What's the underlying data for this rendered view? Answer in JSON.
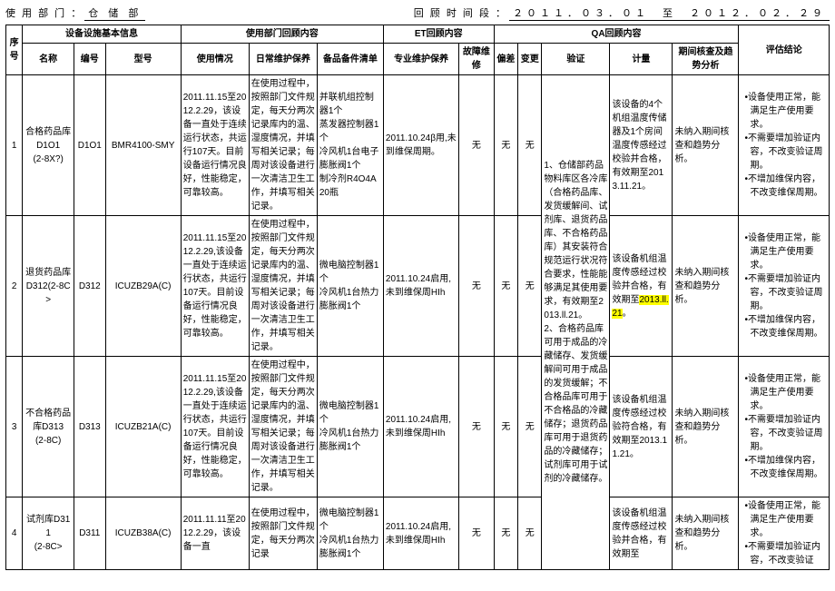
{
  "top": {
    "dept_label": "使 用 部 门 ：",
    "dept_value": "仓 储 部",
    "period_label": "回 顾 时 间 段 ：",
    "period_value": "２０１１．０３．０１　至　２０１２．０２．２９"
  },
  "headers": {
    "seq": "序 号",
    "basic": "设备设施基本信息",
    "name": "名称",
    "code": "编号",
    "model": "型号",
    "dept_review": "使用部门回顾内容",
    "usage": "使用情况",
    "daily": "日常维护保养",
    "spare": "备品备件清单",
    "et": "ET回顾内容",
    "pro": "专业维护保养",
    "fault": "故障维修",
    "qa": "QA回顾内容",
    "dev": "偏差",
    "chg": "变更",
    "ver": "验证",
    "meas": "计量",
    "trend": "期间核查及趋势分析",
    "conc": "评估结论"
  },
  "verification_shared": "1、仓储部药品物料库区各冷库（合格药品库、发货缓解间、试剂库、退货药品库、不合格药品库）其安装符合规范运行状况符合要求，性能能够满足其使用要求，有效期至2013.ll.21。\n2、合格药品库可用于成品的冷藏储存、发货缓解间可用于成品的发货缓解；不合格品库可用于不合格品的冷藏储存；退货药品库可用于退货药品的冷藏储存；试剂库可用于试剂的冷藏储存。",
  "rows": [
    {
      "seq": "1",
      "name": "合格药品库D1O1\n(2-8X?)",
      "code": "D1O1",
      "model": "BMR4100-SMY",
      "usage": "2011.11.15至2012.2.29，该设备一直处于连续运行状态，共运行107天。目前设备运行情况良好，性能稳定，可靠较高。",
      "daily": "在使用过程中，按照部门文件规定，每天分两次记录库内的温、湿度情况，并填写相关记录；每周对该设备进行一次清洁卫生工作，并填写相关记录。",
      "spare": "并联机组控制器1个\n蒸发器控制器1个\n冷风机1台电子膨胀阀1个\n制冷剂R4O4A20瓶",
      "pro": "2011.10.24β用,未到维保周期。",
      "fault": "无",
      "dev": "无",
      "chg": "无",
      "meas": "该设备的4个机组温度传储器及1个房间温度传感经过校验并合格，有效期至2013.11.21。",
      "trend": "未纳入期间核查和趋势分析。",
      "conc": [
        "设备使用正常，能满足生产使用要求。",
        "不需要增加验证内容，不改变验证周期。",
        "不增加维保内容，不改变维保周期。"
      ]
    },
    {
      "seq": "2",
      "name": "退货药品库D312(2-8C>",
      "code": "D312",
      "model": "ICUZB29A(C)",
      "usage": "2011.11.15至2012.2.29,该设备一直处于连续运行状态，共运行107天。目前设备运行情况良好，性能稳定，可靠较高。",
      "daily": "在使用过程中，按照部门文件规定，每天分两次记录库内的温、湿度情况，并填写相关记录；每周对该设备进行一次清洁卫生工作，并填写相关记录。",
      "spare": "微电脑控制器1个\n冷风机1台热力膨胀阀1个",
      "pro": "2011.10.24启用,未到维保周HIh",
      "fault": "无",
      "dev": "无",
      "chg": "无",
      "meas": "该设备机组温度传感经过校验并合格，有效期至2013.ll.21。",
      "meas_hl_tail": true,
      "trend": "未纳入期间核查和趋势分析。",
      "conc": [
        "设备使用正常，能满足生产使用要求。",
        "不需要增加验证内容，不改变验证周期。",
        "不增加维保内容，不改变维保周期。"
      ]
    },
    {
      "seq": "3",
      "name": "不合格药品库D313\n(2-8C)",
      "code": "D313",
      "model": "ICUZB21A(C)",
      "usage": "2011.11.15至2012.2.29,该设备一直处于连续运行状态，共运行107天。目前设备运行情况良好，性能稳定，可靠较高。",
      "daily": "在使用过程中，按照部门文件规定，每天分两次记录库内的温、湿度情况，并填写相关记录；每周对该设备进行一次清洁卫生工作，并填写相关记录。",
      "spare": "微电脑控制器1个\n冷风机1台热力膨胀阀1个",
      "pro": "2011.10.24启用,未到维保周HIh",
      "fault": "无",
      "dev": "无",
      "chg": "无",
      "meas": "该设备机组温度传感经过校验符合格，有效期至2013.11.21。",
      "trend": "未纳入期间核查和趋势分析。",
      "conc": [
        "设备使用正常，能满足生产使用要求。",
        "不需要增加验证内容，不改变验证周期。",
        "不增加维保内容，不改变维保周期。"
      ]
    },
    {
      "seq": "4",
      "name": "试剂库D311\n(2-8C>",
      "code": "D311",
      "model": "ICUZB38A(C)",
      "usage": "2011.11.11至2012.2.29，该设备一直",
      "daily": "在使用过程中，按照部门文件规定，每天分两次记录",
      "spare": "微电脑控制器1个\n冷风机1台热力膨胀阀1个",
      "pro": "2011.10.24启用,未到维保周HIh",
      "fault": "无",
      "dev": "无",
      "chg": "无",
      "meas": "该设备机组温度传感经过校验并合格，有效期至",
      "trend": "未纳入期间核查和趋势分析。",
      "conc": [
        "设备使用正常，能满足生产使用要求。",
        "不需要增加验证内容，不改变验证"
      ]
    }
  ]
}
